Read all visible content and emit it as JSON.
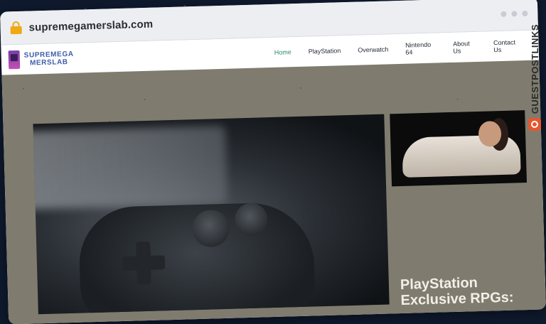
{
  "browser": {
    "url": "supremegamerslab.com"
  },
  "site": {
    "logo_line1": "SUPREMEGA",
    "logo_line2": "MERSLAB",
    "menu": [
      {
        "label": "Home",
        "active": true
      },
      {
        "label": "PlayStation",
        "active": false
      },
      {
        "label": "Overwatch",
        "active": false
      },
      {
        "label": "Nintendo 64",
        "active": false
      },
      {
        "label": "About Us",
        "active": false
      },
      {
        "label": "Contact Us",
        "active": false
      }
    ]
  },
  "content": {
    "headline_line1": "PlayStation",
    "headline_line2": "Exclusive RPGs:"
  },
  "watermark": {
    "text": "GUESTPOSTLINKS"
  },
  "colors": {
    "accent_active": "#2e8a6b",
    "lock": "#f0a814",
    "content_bg": "#7f7c6f",
    "watermark_icon": "#e4572e"
  }
}
